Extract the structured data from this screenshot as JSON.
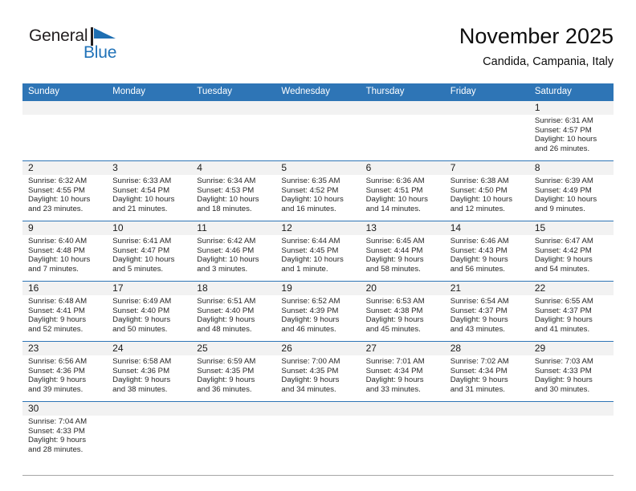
{
  "brand": {
    "name_top": "General",
    "name_bottom": "Blue",
    "flag_icon": "blue-triangle-flag-icon",
    "color_top": "#231f20",
    "color_bottom": "#2072b8"
  },
  "header": {
    "title": "November 2025",
    "subtitle": "Candida, Campania, Italy"
  },
  "theme": {
    "header_blue": "#2e75b6",
    "daynum_band": "#f2f2f2",
    "text": "#262626"
  },
  "weekdays": [
    "Sunday",
    "Monday",
    "Tuesday",
    "Wednesday",
    "Thursday",
    "Friday",
    "Saturday"
  ],
  "weeks": [
    [
      {
        "day": "",
        "sunrise": "",
        "sunset": "",
        "daylight1": "",
        "daylight2": ""
      },
      {
        "day": "",
        "sunrise": "",
        "sunset": "",
        "daylight1": "",
        "daylight2": ""
      },
      {
        "day": "",
        "sunrise": "",
        "sunset": "",
        "daylight1": "",
        "daylight2": ""
      },
      {
        "day": "",
        "sunrise": "",
        "sunset": "",
        "daylight1": "",
        "daylight2": ""
      },
      {
        "day": "",
        "sunrise": "",
        "sunset": "",
        "daylight1": "",
        "daylight2": ""
      },
      {
        "day": "",
        "sunrise": "",
        "sunset": "",
        "daylight1": "",
        "daylight2": ""
      },
      {
        "day": "1",
        "sunrise": "Sunrise: 6:31 AM",
        "sunset": "Sunset: 4:57 PM",
        "daylight1": "Daylight: 10 hours",
        "daylight2": "and 26 minutes."
      }
    ],
    [
      {
        "day": "2",
        "sunrise": "Sunrise: 6:32 AM",
        "sunset": "Sunset: 4:55 PM",
        "daylight1": "Daylight: 10 hours",
        "daylight2": "and 23 minutes."
      },
      {
        "day": "3",
        "sunrise": "Sunrise: 6:33 AM",
        "sunset": "Sunset: 4:54 PM",
        "daylight1": "Daylight: 10 hours",
        "daylight2": "and 21 minutes."
      },
      {
        "day": "4",
        "sunrise": "Sunrise: 6:34 AM",
        "sunset": "Sunset: 4:53 PM",
        "daylight1": "Daylight: 10 hours",
        "daylight2": "and 18 minutes."
      },
      {
        "day": "5",
        "sunrise": "Sunrise: 6:35 AM",
        "sunset": "Sunset: 4:52 PM",
        "daylight1": "Daylight: 10 hours",
        "daylight2": "and 16 minutes."
      },
      {
        "day": "6",
        "sunrise": "Sunrise: 6:36 AM",
        "sunset": "Sunset: 4:51 PM",
        "daylight1": "Daylight: 10 hours",
        "daylight2": "and 14 minutes."
      },
      {
        "day": "7",
        "sunrise": "Sunrise: 6:38 AM",
        "sunset": "Sunset: 4:50 PM",
        "daylight1": "Daylight: 10 hours",
        "daylight2": "and 12 minutes."
      },
      {
        "day": "8",
        "sunrise": "Sunrise: 6:39 AM",
        "sunset": "Sunset: 4:49 PM",
        "daylight1": "Daylight: 10 hours",
        "daylight2": "and 9 minutes."
      }
    ],
    [
      {
        "day": "9",
        "sunrise": "Sunrise: 6:40 AM",
        "sunset": "Sunset: 4:48 PM",
        "daylight1": "Daylight: 10 hours",
        "daylight2": "and 7 minutes."
      },
      {
        "day": "10",
        "sunrise": "Sunrise: 6:41 AM",
        "sunset": "Sunset: 4:47 PM",
        "daylight1": "Daylight: 10 hours",
        "daylight2": "and 5 minutes."
      },
      {
        "day": "11",
        "sunrise": "Sunrise: 6:42 AM",
        "sunset": "Sunset: 4:46 PM",
        "daylight1": "Daylight: 10 hours",
        "daylight2": "and 3 minutes."
      },
      {
        "day": "12",
        "sunrise": "Sunrise: 6:44 AM",
        "sunset": "Sunset: 4:45 PM",
        "daylight1": "Daylight: 10 hours",
        "daylight2": "and 1 minute."
      },
      {
        "day": "13",
        "sunrise": "Sunrise: 6:45 AM",
        "sunset": "Sunset: 4:44 PM",
        "daylight1": "Daylight: 9 hours",
        "daylight2": "and 58 minutes."
      },
      {
        "day": "14",
        "sunrise": "Sunrise: 6:46 AM",
        "sunset": "Sunset: 4:43 PM",
        "daylight1": "Daylight: 9 hours",
        "daylight2": "and 56 minutes."
      },
      {
        "day": "15",
        "sunrise": "Sunrise: 6:47 AM",
        "sunset": "Sunset: 4:42 PM",
        "daylight1": "Daylight: 9 hours",
        "daylight2": "and 54 minutes."
      }
    ],
    [
      {
        "day": "16",
        "sunrise": "Sunrise: 6:48 AM",
        "sunset": "Sunset: 4:41 PM",
        "daylight1": "Daylight: 9 hours",
        "daylight2": "and 52 minutes."
      },
      {
        "day": "17",
        "sunrise": "Sunrise: 6:49 AM",
        "sunset": "Sunset: 4:40 PM",
        "daylight1": "Daylight: 9 hours",
        "daylight2": "and 50 minutes."
      },
      {
        "day": "18",
        "sunrise": "Sunrise: 6:51 AM",
        "sunset": "Sunset: 4:40 PM",
        "daylight1": "Daylight: 9 hours",
        "daylight2": "and 48 minutes."
      },
      {
        "day": "19",
        "sunrise": "Sunrise: 6:52 AM",
        "sunset": "Sunset: 4:39 PM",
        "daylight1": "Daylight: 9 hours",
        "daylight2": "and 46 minutes."
      },
      {
        "day": "20",
        "sunrise": "Sunrise: 6:53 AM",
        "sunset": "Sunset: 4:38 PM",
        "daylight1": "Daylight: 9 hours",
        "daylight2": "and 45 minutes."
      },
      {
        "day": "21",
        "sunrise": "Sunrise: 6:54 AM",
        "sunset": "Sunset: 4:37 PM",
        "daylight1": "Daylight: 9 hours",
        "daylight2": "and 43 minutes."
      },
      {
        "day": "22",
        "sunrise": "Sunrise: 6:55 AM",
        "sunset": "Sunset: 4:37 PM",
        "daylight1": "Daylight: 9 hours",
        "daylight2": "and 41 minutes."
      }
    ],
    [
      {
        "day": "23",
        "sunrise": "Sunrise: 6:56 AM",
        "sunset": "Sunset: 4:36 PM",
        "daylight1": "Daylight: 9 hours",
        "daylight2": "and 39 minutes."
      },
      {
        "day": "24",
        "sunrise": "Sunrise: 6:58 AM",
        "sunset": "Sunset: 4:36 PM",
        "daylight1": "Daylight: 9 hours",
        "daylight2": "and 38 minutes."
      },
      {
        "day": "25",
        "sunrise": "Sunrise: 6:59 AM",
        "sunset": "Sunset: 4:35 PM",
        "daylight1": "Daylight: 9 hours",
        "daylight2": "and 36 minutes."
      },
      {
        "day": "26",
        "sunrise": "Sunrise: 7:00 AM",
        "sunset": "Sunset: 4:35 PM",
        "daylight1": "Daylight: 9 hours",
        "daylight2": "and 34 minutes."
      },
      {
        "day": "27",
        "sunrise": "Sunrise: 7:01 AM",
        "sunset": "Sunset: 4:34 PM",
        "daylight1": "Daylight: 9 hours",
        "daylight2": "and 33 minutes."
      },
      {
        "day": "28",
        "sunrise": "Sunrise: 7:02 AM",
        "sunset": "Sunset: 4:34 PM",
        "daylight1": "Daylight: 9 hours",
        "daylight2": "and 31 minutes."
      },
      {
        "day": "29",
        "sunrise": "Sunrise: 7:03 AM",
        "sunset": "Sunset: 4:33 PM",
        "daylight1": "Daylight: 9 hours",
        "daylight2": "and 30 minutes."
      }
    ],
    [
      {
        "day": "30",
        "sunrise": "Sunrise: 7:04 AM",
        "sunset": "Sunset: 4:33 PM",
        "daylight1": "Daylight: 9 hours",
        "daylight2": "and 28 minutes."
      },
      {
        "day": "",
        "sunrise": "",
        "sunset": "",
        "daylight1": "",
        "daylight2": ""
      },
      {
        "day": "",
        "sunrise": "",
        "sunset": "",
        "daylight1": "",
        "daylight2": ""
      },
      {
        "day": "",
        "sunrise": "",
        "sunset": "",
        "daylight1": "",
        "daylight2": ""
      },
      {
        "day": "",
        "sunrise": "",
        "sunset": "",
        "daylight1": "",
        "daylight2": ""
      },
      {
        "day": "",
        "sunrise": "",
        "sunset": "",
        "daylight1": "",
        "daylight2": ""
      },
      {
        "day": "",
        "sunrise": "",
        "sunset": "",
        "daylight1": "",
        "daylight2": ""
      }
    ]
  ]
}
